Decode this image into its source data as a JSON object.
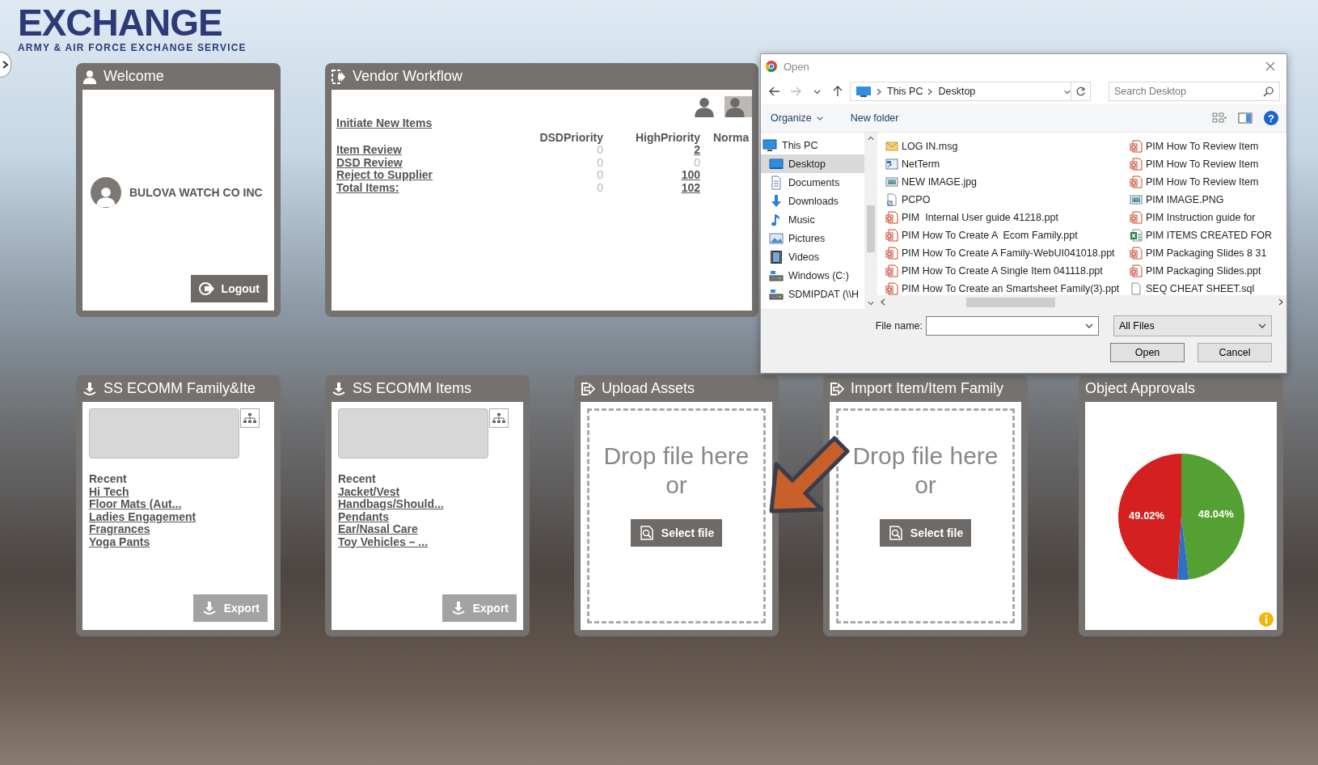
{
  "logo": {
    "wordmark": "EXCHANGE",
    "tagline": "ARMY & AIR FORCE EXCHANGE SERVICE"
  },
  "welcome": {
    "title": "Welcome",
    "user": "BULOVA WATCH CO INC",
    "logout": "Logout"
  },
  "vendor_workflow": {
    "title": "Vendor Workflow",
    "initiate": "Initiate New Items",
    "columns": [
      "DSDPriority",
      "HighPriority",
      "Norma"
    ],
    "rows": [
      {
        "label": "Item Review",
        "cells": [
          {
            "value": "0",
            "faint": true
          },
          {
            "value": "2",
            "faint": false
          }
        ]
      },
      {
        "label": "DSD Review",
        "cells": [
          {
            "value": "0",
            "faint": true
          },
          {
            "value": "0",
            "faint": true
          }
        ]
      },
      {
        "label": "Reject to Supplier",
        "cells": [
          {
            "value": "0",
            "faint": true
          },
          {
            "value": "100",
            "faint": false
          }
        ]
      },
      {
        "label": "Total Items:",
        "cells": [
          {
            "value": "0",
            "faint": true
          },
          {
            "value": "102",
            "faint": false
          }
        ]
      }
    ]
  },
  "widgets": [
    {
      "kind": "recent_list",
      "title": "SS ECOMM Family&Ite",
      "recent_label": "Recent",
      "links": [
        "Hi Tech",
        "Floor Mats (Aut...",
        "Ladies Engagement",
        "Fragrances",
        "Yoga Pants"
      ],
      "export": {
        "label": "Export",
        "disabled": true
      }
    },
    {
      "kind": "recent_list",
      "title": "SS ECOMM Items",
      "recent_label": "Recent",
      "links": [
        "Jacket/Vest",
        "Handbags/Should...",
        "Pendants",
        "Ear/Nasal Care",
        "Toy Vehicles – ..."
      ],
      "export": {
        "label": "Export",
        "disabled": true
      }
    },
    {
      "kind": "upload",
      "title": "Upload Assets",
      "drop_text": "Drop file here",
      "or": "or",
      "button": "Select file"
    },
    {
      "kind": "upload",
      "title": "Import Item/Item Family",
      "drop_text": "Drop file here",
      "or": "or",
      "button": "Select file"
    },
    {
      "kind": "approvals",
      "title": "Object Approvals",
      "chart_data": {
        "type": "pie",
        "values": [
          48.04,
          2.94,
          49.02
        ],
        "colors": [
          "#55a033",
          "#2f6fc4",
          "#d42020"
        ],
        "value_labels": [
          "48.04%",
          null,
          "49.02%"
        ]
      }
    }
  ],
  "dialog": {
    "title": "Open",
    "path": [
      "This PC",
      "Desktop"
    ],
    "search": {
      "placeholder": "Search Desktop"
    },
    "organize": "Organize",
    "new_folder": "New folder",
    "help": "?",
    "nav": [
      {
        "label": "This PC",
        "kind": "pc",
        "selected": false
      },
      {
        "label": "Desktop",
        "kind": "desktop",
        "selected": true
      },
      {
        "label": "Documents",
        "kind": "documents",
        "selected": false
      },
      {
        "label": "Downloads",
        "kind": "downloads",
        "selected": false
      },
      {
        "label": "Music",
        "kind": "music",
        "selected": false
      },
      {
        "label": "Pictures",
        "kind": "pictures",
        "selected": false
      },
      {
        "label": "Videos",
        "kind": "videos",
        "selected": false
      },
      {
        "label": "Windows (C:)",
        "kind": "drive",
        "selected": false
      },
      {
        "label": "SDMIPDAT (\\\\H",
        "kind": "drive",
        "selected": false
      }
    ],
    "files": [
      {
        "name": "LOG IN.msg",
        "kind": "mail"
      },
      {
        "name": "NetTerm",
        "kind": "program"
      },
      {
        "name": "NEW IMAGE.jpg",
        "kind": "image"
      },
      {
        "name": "PCPO",
        "kind": "shortcut"
      },
      {
        "name": "PIM  Internal User guide 41218.ppt",
        "kind": "slides"
      },
      {
        "name": "PIM How To Create A  Ecom Family.ppt",
        "kind": "slides"
      },
      {
        "name": "PIM How To Create A Family-WebUI041018.ppt",
        "kind": "slides"
      },
      {
        "name": "PIM How To Create A Single Item 041118.ppt",
        "kind": "slides"
      },
      {
        "name": "PIM How To Create an Smartsheet Family(3).ppt",
        "kind": "slides"
      },
      {
        "name": "PIM How To Review Item",
        "kind": "slides"
      },
      {
        "name": "PIM How To Review Item",
        "kind": "slides"
      },
      {
        "name": "PIM How To Review Item",
        "kind": "slides"
      },
      {
        "name": "PIM IMAGE.PNG",
        "kind": "image"
      },
      {
        "name": "PIM Instruction guide for",
        "kind": "slides"
      },
      {
        "name": "PIM ITEMS CREATED FOR",
        "kind": "sheet"
      },
      {
        "name": "PIM Packaging Slides 8 31",
        "kind": "slides"
      },
      {
        "name": "PIM Packaging Slides.ppt",
        "kind": "slides"
      },
      {
        "name": "SEQ CHEAT SHEET.sql",
        "kind": "file"
      }
    ],
    "file_name_label": "File name:",
    "filter": "All Files",
    "open": "Open",
    "cancel": "Cancel"
  }
}
